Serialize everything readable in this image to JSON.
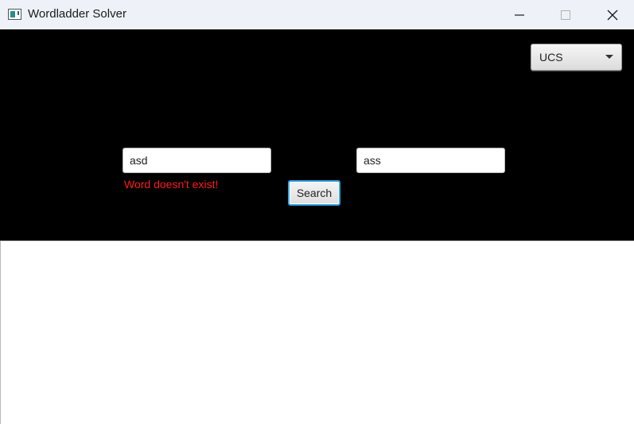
{
  "window": {
    "title": "Wordladder Solver",
    "app_icon": "app-window-icon",
    "controls": {
      "minimize_icon": "minimize-icon",
      "maximize_icon": "maximize-icon",
      "close_icon": "close-icon"
    }
  },
  "toolbar": {
    "algorithm_select": {
      "value": "UCS",
      "icon": "chevron-down-icon"
    }
  },
  "form": {
    "start_word": {
      "value": "asd"
    },
    "end_word": {
      "value": "ass"
    },
    "error_message": "Word doesn't exist!",
    "search_label": "Search"
  },
  "colors": {
    "title_bar": "#eef2f8",
    "top_panel": "#000000",
    "error_text": "#ff1a1a",
    "focus_border": "#3aa7e8",
    "result_area": "#ffffff"
  }
}
